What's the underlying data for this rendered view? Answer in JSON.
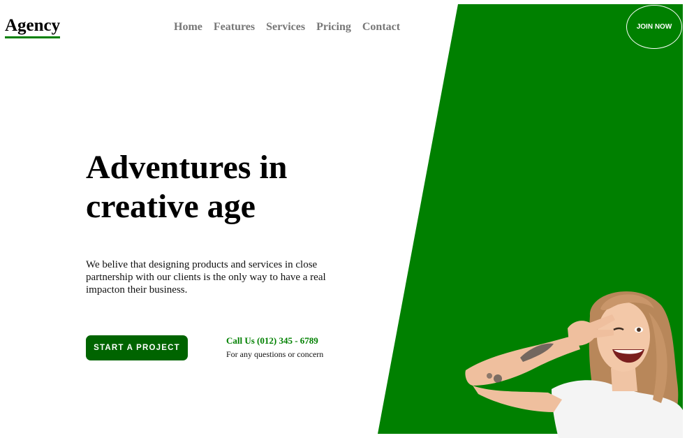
{
  "header": {
    "logo": "Agency",
    "nav": [
      "Home",
      "Features",
      "Services",
      "Pricing",
      "Contact"
    ],
    "join_label": "JOIN NOW"
  },
  "hero": {
    "title_line1": "Adventures in",
    "title_line2": "creative age",
    "description": "We belive that designing products and services in close partnership with our clients is the only way to have a real impacton their business.",
    "cta_label": "START A PROJECT",
    "call_text": "Call Us (012) 345 - 6789",
    "call_note": "For any questions or concern"
  },
  "colors": {
    "accent_green": "#008000",
    "button_green": "#006400",
    "nav_gray": "#777777"
  },
  "icons": {
    "hero_image": "smiling-woman-peace-sign-photo"
  }
}
